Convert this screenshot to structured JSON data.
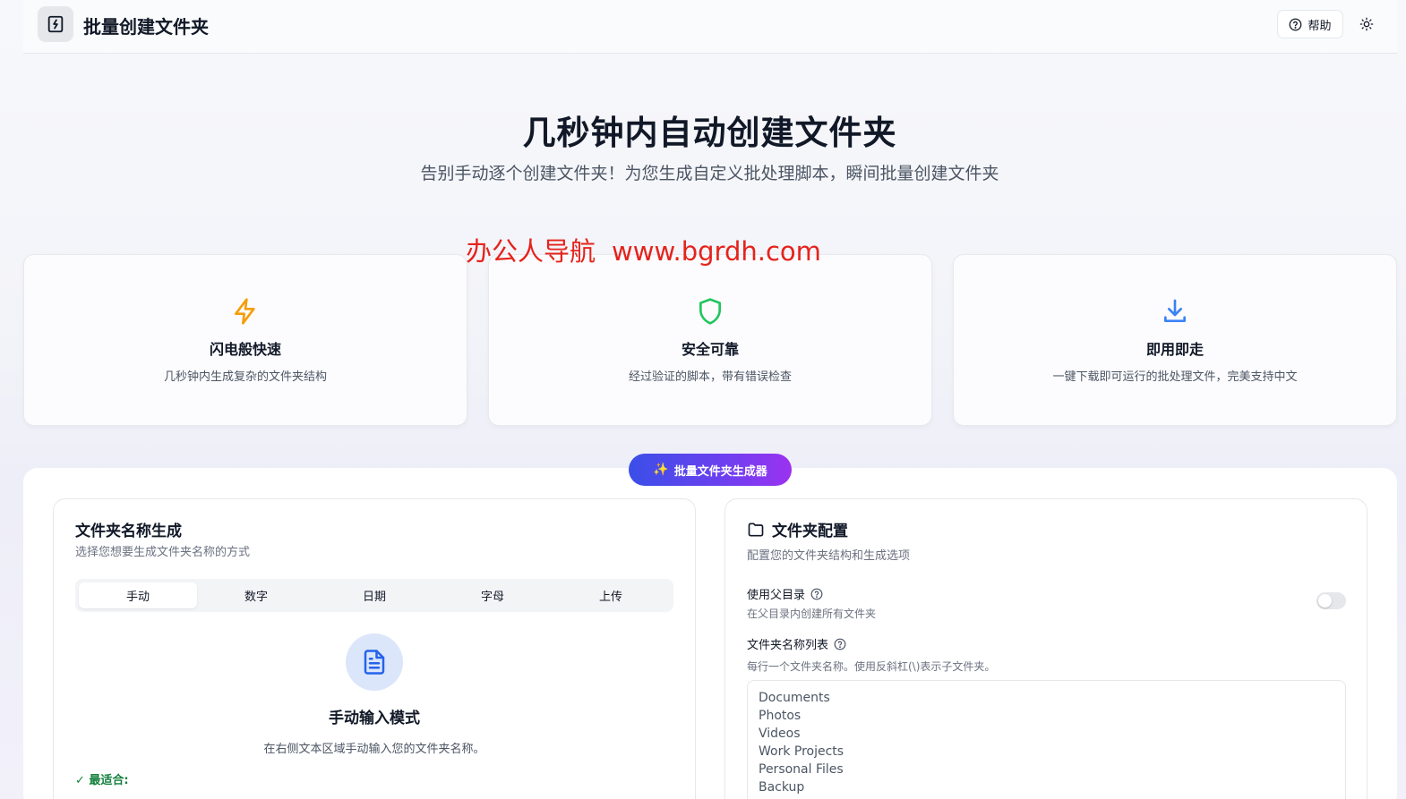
{
  "header": {
    "brand": "批量创建文件夹",
    "help_label": "帮助"
  },
  "hero": {
    "title": "几秒钟内自动创建文件夹",
    "subtitle": "告别手动逐个创建文件夹！为您生成自定义批处理脚本，瞬间批量创建文件夹"
  },
  "watermark": {
    "cn": "办公人导航",
    "url": "www.bgrdh.com"
  },
  "features": [
    {
      "icon": "lightning-icon",
      "title": "闪电般快速",
      "desc": "几秒钟内生成复杂的文件夹结构",
      "color": "#f59e0b"
    },
    {
      "icon": "shield-icon",
      "title": "安全可靠",
      "desc": "经过验证的脚本，带有错误检查",
      "color": "#22c55e"
    },
    {
      "icon": "download-icon",
      "title": "即用即走",
      "desc": "一键下载即可运行的批处理文件，完美支持中文",
      "color": "#3b82f6"
    }
  ],
  "generator_pill": "批量文件夹生成器",
  "left_card": {
    "title": "文件夹名称生成",
    "subtitle": "选择您想要生成文件夹名称的方式",
    "tabs": [
      "手动",
      "数字",
      "日期",
      "字母",
      "上传"
    ],
    "active_tab": "手动",
    "mode_title": "手动输入模式",
    "mode_desc": "在右侧文本区域手动输入您的文件夹名称。",
    "best_for": "✓ 最适合:"
  },
  "right_card": {
    "title": "文件夹配置",
    "subtitle": "配置您的文件夹结构和生成选项",
    "parent_label": "使用父目录",
    "parent_hint": "在父目录内创建所有文件夹",
    "parent_enabled": false,
    "list_label": "文件夹名称列表",
    "list_hint": "每行一个文件夹名称。使用反斜杠(\\)表示子文件夹。",
    "folder_names": [
      "Documents",
      "Photos",
      "Videos",
      "Work Projects",
      "Personal Files",
      "Backup"
    ]
  },
  "colors": {
    "accent_start": "#3b4fe8",
    "accent_end": "#9b32f0",
    "watermark": "#e5231c"
  }
}
